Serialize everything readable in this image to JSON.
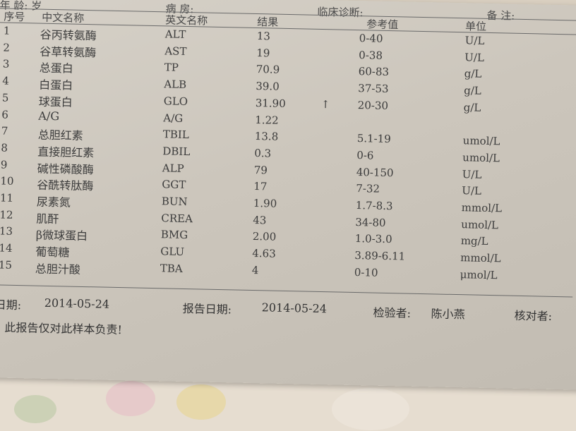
{
  "header_partial": {
    "age_fragment": "年 龄: 岁",
    "ward_fragment": "病 房:",
    "diagnosis_fragment": "临床诊断:",
    "remark_fragment": "备 注:"
  },
  "columns": {
    "no": "序号",
    "cn_name": "中文名称",
    "en_name": "英文名称",
    "result": "结果",
    "reference": "参考值",
    "unit": "单位"
  },
  "rows": [
    {
      "no": "1",
      "cn": "谷丙转氨酶",
      "en": "ALT",
      "result": "13",
      "flag": "",
      "ref": "0-40",
      "unit": "U/L"
    },
    {
      "no": "2",
      "cn": "谷草转氨酶",
      "en": "AST",
      "result": "19",
      "flag": "",
      "ref": "0-38",
      "unit": "U/L"
    },
    {
      "no": "3",
      "cn": "总蛋白",
      "en": "TP",
      "result": "70.9",
      "flag": "",
      "ref": "60-83",
      "unit": "g/L"
    },
    {
      "no": "4",
      "cn": "白蛋白",
      "en": "ALB",
      "result": "39.0",
      "flag": "",
      "ref": "37-53",
      "unit": "g/L"
    },
    {
      "no": "5",
      "cn": "球蛋白",
      "en": "GLO",
      "result": "31.90",
      "flag": "↑",
      "ref": "20-30",
      "unit": "g/L"
    },
    {
      "no": "6",
      "cn": "A/G",
      "en": "A/G",
      "result": "1.22",
      "flag": "",
      "ref": "",
      "unit": ""
    },
    {
      "no": "7",
      "cn": "总胆红素",
      "en": "TBIL",
      "result": "13.8",
      "flag": "",
      "ref": "5.1-19",
      "unit": "umol/L"
    },
    {
      "no": "8",
      "cn": "直接胆红素",
      "en": "DBIL",
      "result": "0.3",
      "flag": "",
      "ref": "0-6",
      "unit": "umol/L"
    },
    {
      "no": "9",
      "cn": "碱性磷酸酶",
      "en": "ALP",
      "result": "79",
      "flag": "",
      "ref": "40-150",
      "unit": "U/L"
    },
    {
      "no": "10",
      "cn": "谷酰转肽酶",
      "en": "GGT",
      "result": "17",
      "flag": "",
      "ref": "7-32",
      "unit": "U/L"
    },
    {
      "no": "11",
      "cn": "尿素氮",
      "en": "BUN",
      "result": "1.90",
      "flag": "",
      "ref": "1.7-8.3",
      "unit": "mmol/L"
    },
    {
      "no": "12",
      "cn": "肌酐",
      "en": "CREA",
      "result": "43",
      "flag": "",
      "ref": "34-80",
      "unit": "umol/L"
    },
    {
      "no": "13",
      "cn": "β微球蛋白",
      "en": "BMG",
      "result": "2.00",
      "flag": "",
      "ref": "1.0-3.0",
      "unit": "mg/L"
    },
    {
      "no": "14",
      "cn": "葡萄糖",
      "en": "GLU",
      "result": "4.63",
      "flag": "",
      "ref": "3.89-6.11",
      "unit": "mmol/L"
    },
    {
      "no": "15",
      "cn": "总胆汁酸",
      "en": "TBA",
      "result": "4",
      "flag": "",
      "ref": "0-10",
      "unit": "μmol/L"
    }
  ],
  "footer": {
    "sample_date_label": "日期:",
    "sample_date": "2014-05-24",
    "report_date_label": "报告日期:",
    "report_date": "2014-05-24",
    "inspector_label": "检验者:",
    "inspector": "陈小燕",
    "checker_label": "核对者:",
    "note": "明: 此报告仅对此样本负责!"
  }
}
